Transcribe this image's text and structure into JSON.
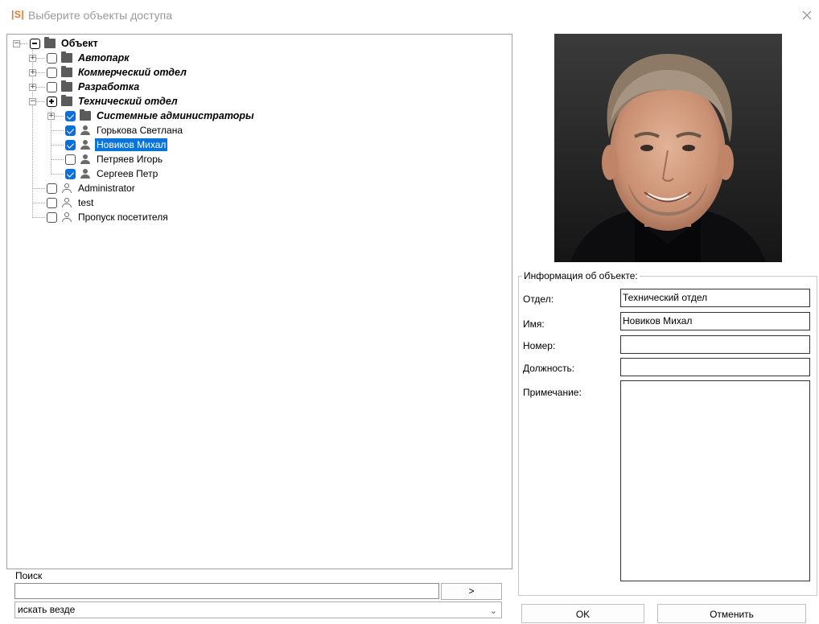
{
  "window": {
    "logo": "|S|",
    "title": "Выберите объекты доступа"
  },
  "tree": {
    "items": [
      {
        "label": "Объект",
        "style": "bold",
        "icon": "folder-icon",
        "check": "partial",
        "expander": "minus"
      },
      {
        "label": "Автопарк",
        "style": "bold-italic",
        "icon": "folder-icon",
        "check": "unchecked",
        "expander": "plus"
      },
      {
        "label": "Коммерческий отдел",
        "style": "bold-italic",
        "icon": "folder-icon",
        "check": "unchecked",
        "expander": "plus"
      },
      {
        "label": "Разработка",
        "style": "bold-italic",
        "icon": "folder-icon",
        "check": "unchecked",
        "expander": "plus"
      },
      {
        "label": "Технический отдел",
        "style": "bold-italic",
        "icon": "folder-icon",
        "check": "partial-plus",
        "expander": "minus"
      },
      {
        "label": "Системные администраторы",
        "style": "bold-italic",
        "icon": "folder-icon",
        "check": "checked",
        "expander": "plus"
      },
      {
        "label": "Горькова Светлана",
        "style": "normal",
        "icon": "person-icon",
        "check": "checked"
      },
      {
        "label": "Новиков Михал",
        "style": "normal",
        "icon": "person-icon",
        "check": "checked",
        "selected": true
      },
      {
        "label": "Петряев Игорь",
        "style": "normal",
        "icon": "person-icon",
        "check": "unchecked"
      },
      {
        "label": "Сергеев Петр",
        "style": "normal",
        "icon": "person-icon",
        "check": "checked"
      },
      {
        "label": "Administrator",
        "style": "normal",
        "icon": "person-outline-icon",
        "check": "unchecked"
      },
      {
        "label": "test",
        "style": "normal",
        "icon": "person-outline-icon",
        "check": "unchecked"
      },
      {
        "label": "Пропуск посетителя",
        "style": "normal",
        "icon": "person-outline-icon",
        "check": "unchecked"
      }
    ]
  },
  "search": {
    "label": "Поиск",
    "value": "",
    "go_label": ">",
    "scope_value": "искать везде"
  },
  "info": {
    "legend": "Информация об объекте:",
    "department_label": "Отдел:",
    "department_value": "Технический отдел",
    "name_label": "Имя:",
    "name_value": "Новиков Михал",
    "number_label": "Номер:",
    "number_value": "",
    "position_label": "Должность:",
    "position_value": "",
    "note_label": "Примечание:",
    "note_value": ""
  },
  "buttons": {
    "ok": "OK",
    "cancel": "Отменить"
  },
  "colors": {
    "selection": "#0a74da",
    "checkbox_checked": "#0a6fd6",
    "logo": "#e8742a"
  }
}
